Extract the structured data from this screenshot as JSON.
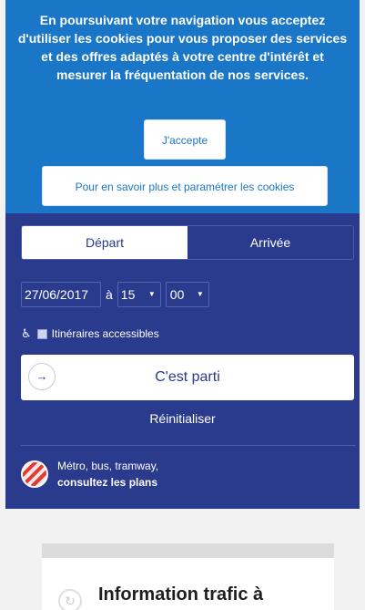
{
  "cookie_banner": {
    "message": "En poursuivant votre navigation vous acceptez d'utiliser les cookies pour vous proposer des services et des offres adaptés à votre centre d'intérêt et mesurer la fréquentation de nos services.",
    "accept_label": "J'accepte",
    "settings_label": "Pour en savoir plus et paramétrer les cookies"
  },
  "journey_form": {
    "tabs": [
      {
        "label": "Départ",
        "active": true
      },
      {
        "label": "Arrivée",
        "active": false
      }
    ],
    "date_value": "27/06/2017",
    "time_separator": "à",
    "hour_value": "15",
    "minute_value": "00",
    "accessibility_label": "Itinéraires accessibles",
    "submit_label": "C'est parti",
    "reset_label": "Réinitialiser"
  },
  "plans_link": {
    "line1": "Métro, bus, tramway,",
    "line2": "consultez les plans"
  },
  "traffic_card": {
    "title": "Information trafic à"
  },
  "colors": {
    "cookie_bg": "#1a76c6",
    "panel_bg": "#2a3a8c",
    "page_bg": "#f2f2f2"
  },
  "icons": {
    "wheelchair": "wheelchair-icon",
    "arrow": "arrow-right-icon",
    "plans": "plans-icon",
    "refresh": "refresh-icon"
  }
}
